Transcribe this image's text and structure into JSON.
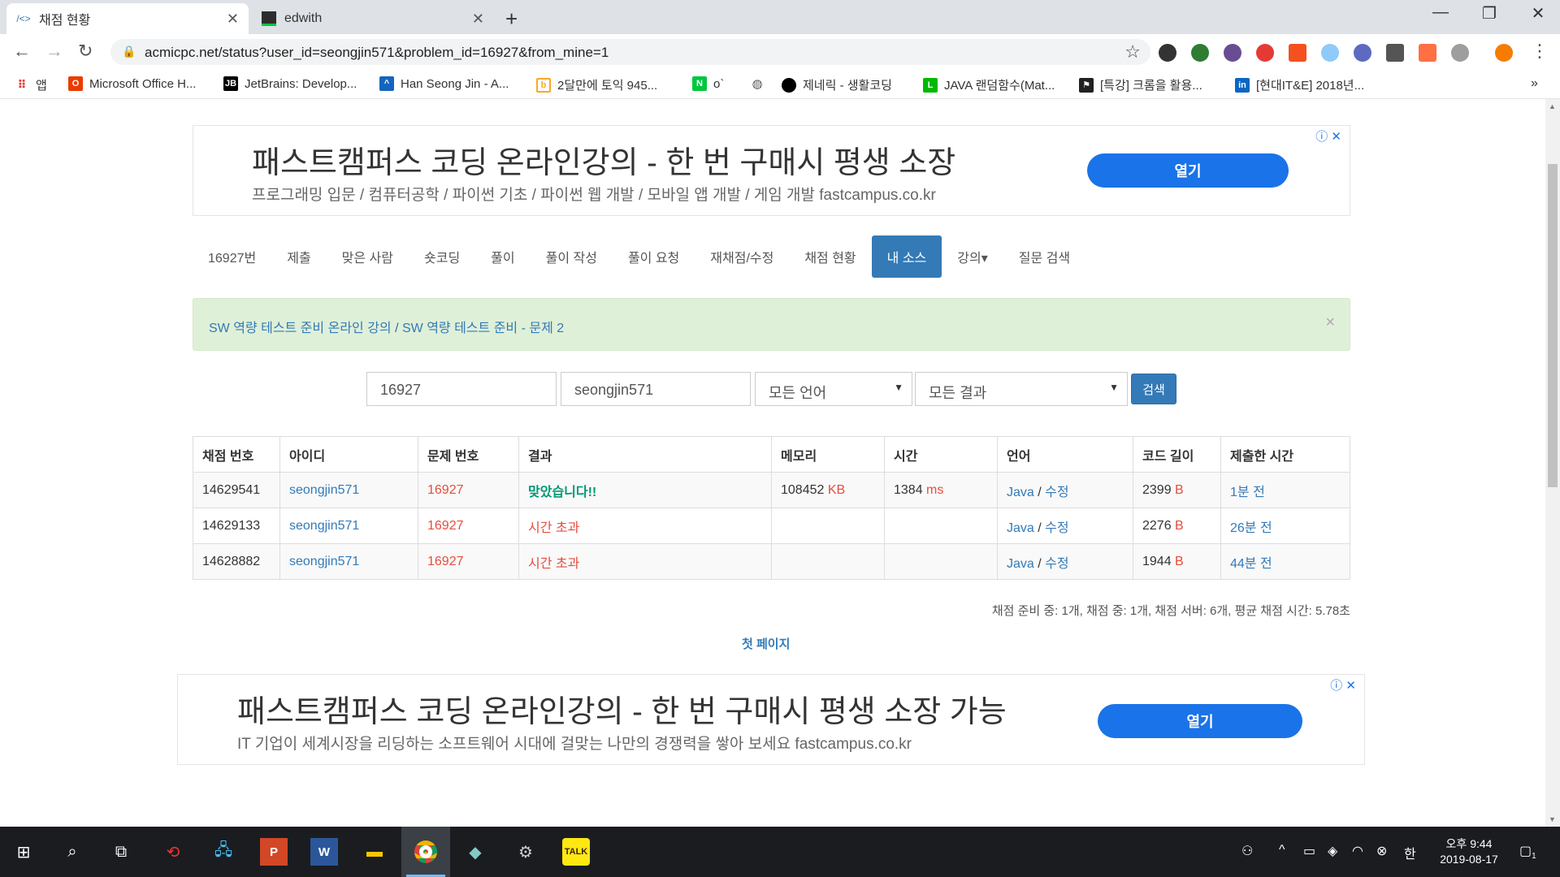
{
  "tabs": [
    {
      "title": "채점 현황",
      "active": true
    },
    {
      "title": "edwith",
      "active": false
    }
  ],
  "address": {
    "url": "acmicpc.net/status?user_id=seongjin571&problem_id=16927&from_mine=1"
  },
  "bookmarks": [
    {
      "label": "앱",
      "icon": "apps-grid-icon"
    },
    {
      "label": "Microsoft Office H...",
      "icon": "office-icon"
    },
    {
      "label": "JetBrains: Develop...",
      "icon": "jetbrains-icon"
    },
    {
      "label": "Han Seong Jin - A...",
      "icon": "atcoder-icon"
    },
    {
      "label": "2달만에 토익 945...",
      "icon": "blog-icon"
    },
    {
      "label": "o`",
      "icon": "naver-icon"
    },
    {
      "label": "",
      "icon": "globe-icon"
    },
    {
      "label": "제네릭 - 생활코딩",
      "icon": "circle-icon"
    },
    {
      "label": "JAVA 랜덤함수(Mat...",
      "icon": "line-icon"
    },
    {
      "label": "[특강] 크롬을 활용...",
      "icon": "flag-icon"
    },
    {
      "label": "[현대IT&E] 2018년...",
      "icon": "linkedin-icon"
    }
  ],
  "ad_top": {
    "title": "패스트캠퍼스 코딩 온라인강의 - 한 번 구매시 평생 소장",
    "subtitle": "프로그래밍 입문 / 컴퓨터공학 / 파이썬 기초 / 파이썬 웹 개발 / 모바일 앱 개발 / 게임 개발 fastcampus.co.kr",
    "button": "열기"
  },
  "ad_bottom": {
    "title": "패스트캠퍼스 코딩 온라인강의 - 한 번 구매시 평생 소장 가능",
    "subtitle": "IT 기업이 세계시장을 리딩하는 소프트웨어 시대에 걸맞는 나만의 경쟁력을 쌓아 보세요 fastcampus.co.kr",
    "button": "열기"
  },
  "problem_nav": [
    "16927번",
    "제출",
    "맞은 사람",
    "숏코딩",
    "풀이",
    "풀이 작성",
    "풀이 요청",
    "재채점/수정",
    "채점 현황",
    "내 소스",
    "강의▾",
    "질문 검색"
  ],
  "problem_nav_active": "내 소스",
  "alert": {
    "part1": "SW 역량 테스트 준비 온라인 강의",
    "sep": " / ",
    "part2": "SW 역량 테스트 준비 - 문제 2",
    "close": "×"
  },
  "search": {
    "problem_id": "16927",
    "user_id": "seongjin571",
    "language": "모든 언어",
    "result": "모든 결과",
    "button": "검색"
  },
  "table": {
    "headers": [
      "채점 번호",
      "아이디",
      "문제 번호",
      "결과",
      "메모리",
      "시간",
      "언어",
      "코드 길이",
      "제출한 시간"
    ],
    "rows": [
      {
        "id": "14629541",
        "user": "seongjin571",
        "problem": "16927",
        "result": "맞았습니다!!",
        "result_type": "ac",
        "memory": "108452",
        "memory_unit": "KB",
        "time": "1384",
        "time_unit": "ms",
        "lang": "Java",
        "edit": "수정",
        "length": "2399",
        "length_unit": "B",
        "submitted": "1분 전"
      },
      {
        "id": "14629133",
        "user": "seongjin571",
        "problem": "16927",
        "result": "시간 초과",
        "result_type": "tle",
        "memory": "",
        "memory_unit": "",
        "time": "",
        "time_unit": "",
        "lang": "Java",
        "edit": "수정",
        "length": "2276",
        "length_unit": "B",
        "submitted": "26분 전"
      },
      {
        "id": "14628882",
        "user": "seongjin571",
        "problem": "16927",
        "result": "시간 초과",
        "result_type": "tle",
        "memory": "",
        "memory_unit": "",
        "time": "",
        "time_unit": "",
        "lang": "Java",
        "edit": "수정",
        "length": "1944",
        "length_unit": "B",
        "submitted": "44분 전"
      }
    ]
  },
  "judge_info": "채점 준비 중: 1개, 채점 중: 1개, 채점 서버: 6개, 평균 채점 시간: 5.78초",
  "first_page": "첫 페이지",
  "taskbar": {
    "ime": "한",
    "clock_time": "오후 9:44",
    "clock_date": "2019-08-17",
    "notification_count": "1"
  },
  "colors": {
    "accent": "#337ab7",
    "success_bg": "#dff0d8",
    "ac": "#009874",
    "error": "#e74c3c",
    "ad_button": "#1a73e8"
  }
}
